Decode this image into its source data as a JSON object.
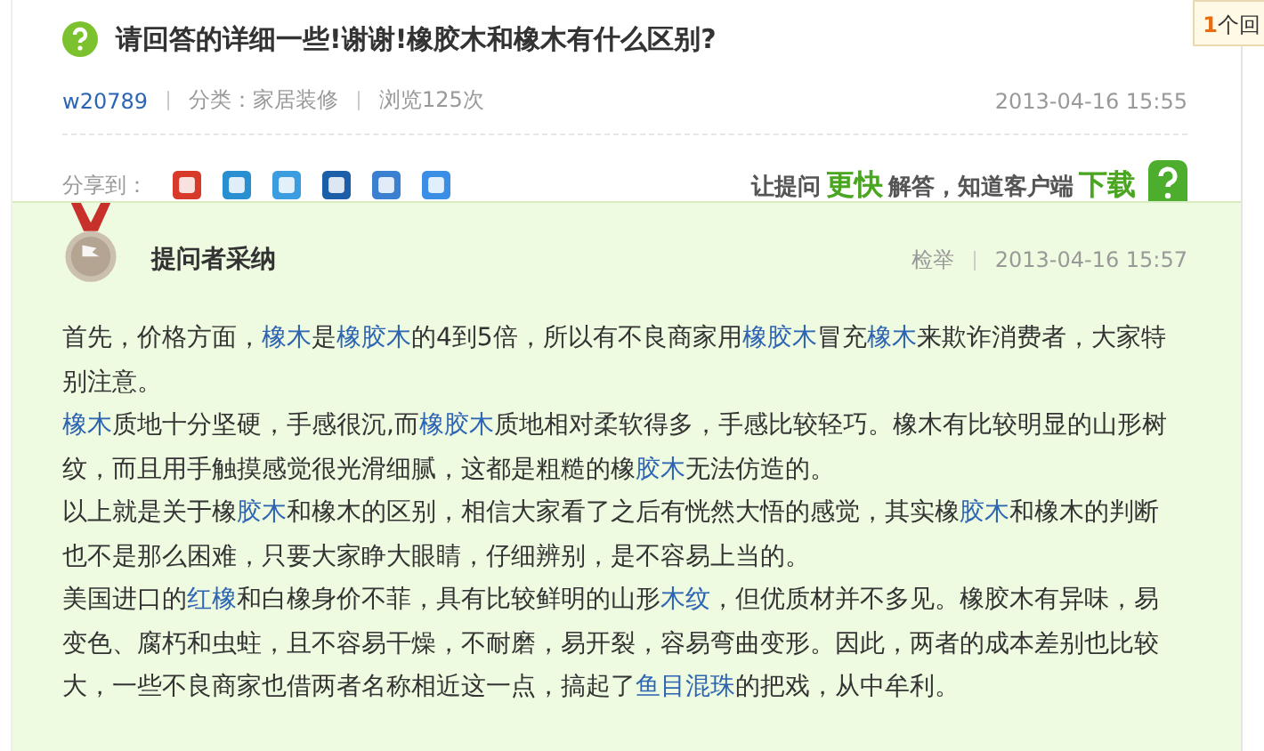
{
  "side_tab": {
    "count": "1",
    "label": "个回"
  },
  "question": {
    "title": "请回答的详细一些!谢谢!橡胶木和橡木有什么区别?",
    "author": "w20789",
    "category": "分类：家居装修",
    "views": "浏览125次",
    "time": "2013-04-16 15:55"
  },
  "share": {
    "label": "分享到：",
    "services": [
      {
        "color": "#d83a2a"
      },
      {
        "color": "#2a8fd0"
      },
      {
        "color": "#3b9de0"
      },
      {
        "color": "#1d5ea8"
      },
      {
        "color": "#3b7fd0"
      },
      {
        "color": "#3a8ee6"
      }
    ]
  },
  "promo": {
    "text_1": "让提问",
    "highlight_1": "更快",
    "text_2": "解答，知道客户端",
    "highlight_2": "下载"
  },
  "answer": {
    "badge": "提问者采纳",
    "report": "检举",
    "time": "2013-04-16 15:57",
    "paragraphs": [
      [
        {
          "text": "首先，价格方面，",
          "link": false
        },
        {
          "text": "橡木",
          "link": true
        },
        {
          "text": "是",
          "link": false
        },
        {
          "text": "橡胶木",
          "link": true
        },
        {
          "text": "的4到5倍，所以有不良商家用",
          "link": false
        },
        {
          "text": "橡胶木",
          "link": true
        },
        {
          "text": "冒充",
          "link": false
        },
        {
          "text": "橡木",
          "link": true
        },
        {
          "text": "来欺诈消费者，大家特别注意。",
          "link": false
        }
      ],
      [
        {
          "text": "橡木",
          "link": true
        },
        {
          "text": "质地十分坚硬，手感很沉,而",
          "link": false
        },
        {
          "text": "橡胶木",
          "link": true
        },
        {
          "text": "质地相对柔软得多，手感比较轻巧。橡木有比较明显的山形树纹，而且用手触摸感觉很光滑细腻，这都是粗糙的橡",
          "link": false
        },
        {
          "text": "胶木",
          "link": true
        },
        {
          "text": "无法仿造的。",
          "link": false
        }
      ],
      [
        {
          "text": "以上就是关于橡",
          "link": false
        },
        {
          "text": "胶木",
          "link": true
        },
        {
          "text": "和橡木的区别，相信大家看了之后有恍然大悟的感觉，其实橡",
          "link": false
        },
        {
          "text": "胶木",
          "link": true
        },
        {
          "text": "和橡木的判断也不是那么困难，只要大家睁大眼睛，仔细辨别，是不容易上当的。",
          "link": false
        }
      ],
      [
        {
          "text": "美国进口的",
          "link": false
        },
        {
          "text": "红橡",
          "link": true
        },
        {
          "text": "和白橡身价不菲，具有比较鲜明的山形",
          "link": false
        },
        {
          "text": "木纹",
          "link": true
        },
        {
          "text": "，但优质材并不多见。橡胶木有异味，易变色、腐朽和虫蛀，且不容易干燥，不耐磨，易开裂，容易弯曲变形。因此，两者的成本差别也比较大，一些不良商家也借两者名称相近这一点，搞起了",
          "link": false
        },
        {
          "text": "鱼目混珠",
          "link": true
        },
        {
          "text": "的把戏，从中牟利。",
          "link": false
        }
      ]
    ]
  }
}
